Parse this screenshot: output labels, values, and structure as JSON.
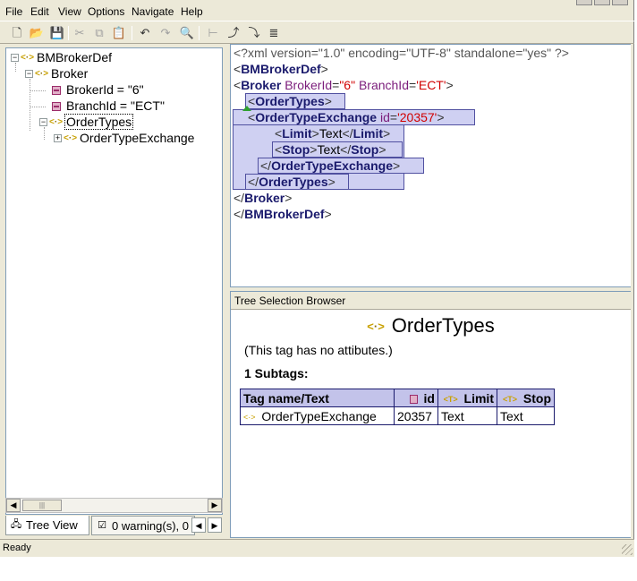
{
  "menu": [
    "File",
    "Edit",
    "View",
    "Options",
    "Navigate",
    "Help"
  ],
  "toolbar": {
    "icons": [
      "new-file-icon",
      "open-folder-icon",
      "save-icon",
      "cut-icon",
      "copy-icon",
      "paste-icon",
      "undo-icon",
      "redo-icon",
      "find-icon",
      "add-child-icon",
      "add-sibling-icon",
      "move-down-icon",
      "list-icon"
    ]
  },
  "tree": {
    "root": "BMBrokerDef",
    "broker": "Broker",
    "broker_id": "BrokerId = \"6\"",
    "branch_id": "BranchId = \"ECT\"",
    "order_types": "OrderTypes",
    "order_type_exchange": "OrderTypeExchange"
  },
  "tabs": {
    "tree_view": "Tree View",
    "warnings": "0 warning(s), 0"
  },
  "xml": {
    "decl": "<?xml version=\"1.0\" encoding=\"UTF-8\" standalone=\"yes\" ?>",
    "bmbrokerdef": "BMBrokerDef",
    "broker": "Broker",
    "broker_attr1": "BrokerId",
    "broker_val1": "\"6\"",
    "broker_attr2": "BranchId",
    "broker_val2": "'ECT'",
    "ordertypes": "OrderTypes",
    "ordertypeexchange": "OrderTypeExchange",
    "ote_attr": "id",
    "ote_val": "'20357'",
    "limit": "Limit",
    "stop": "Stop",
    "text": "Text"
  },
  "browser": {
    "header": "Tree Selection Browser",
    "title": "OrderTypes",
    "no_attr": "(This tag has no attibutes.)",
    "subtags": "1 Subtags:",
    "columns": [
      "Tag name/Text",
      "id",
      "Limit",
      "Stop"
    ],
    "rows": [
      [
        "OrderTypeExchange",
        "20357",
        "Text",
        "Text"
      ]
    ]
  },
  "status": "Ready",
  "colors": {
    "highlight": "#c3c3ea",
    "tag": "#1a1a6c",
    "attr_name": "#7b1d7b",
    "attr_value": "#d10000"
  }
}
